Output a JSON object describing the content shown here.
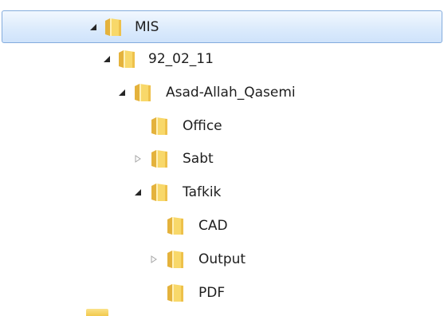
{
  "tree": {
    "items": [
      {
        "label": "MIS",
        "expander": "expanded",
        "selected": true
      },
      {
        "label": "92_02_11",
        "expander": "expanded",
        "selected": false
      },
      {
        "label": "Asad-Allah_Qasemi",
        "expander": "expanded",
        "selected": false
      },
      {
        "label": "Office",
        "expander": "none",
        "selected": false
      },
      {
        "label": "Sabt",
        "expander": "collapsed",
        "selected": false
      },
      {
        "label": "Tafkik",
        "expander": "expanded",
        "selected": false
      },
      {
        "label": "CAD",
        "expander": "none",
        "selected": false
      },
      {
        "label": "Output",
        "expander": "collapsed",
        "selected": false
      },
      {
        "label": "PDF",
        "expander": "none",
        "selected": false
      }
    ]
  },
  "icons": {
    "folder": "folder-icon",
    "expanded": "triangle-expanded-icon",
    "collapsed": "triangle-collapsed-icon"
  },
  "colors": {
    "selection_border": "#84acdd",
    "selection_fill": "#dcebfc",
    "folder_yellow": "#f5cd55",
    "expander_dark": "#262626",
    "expander_light": "#a6a6a6"
  }
}
